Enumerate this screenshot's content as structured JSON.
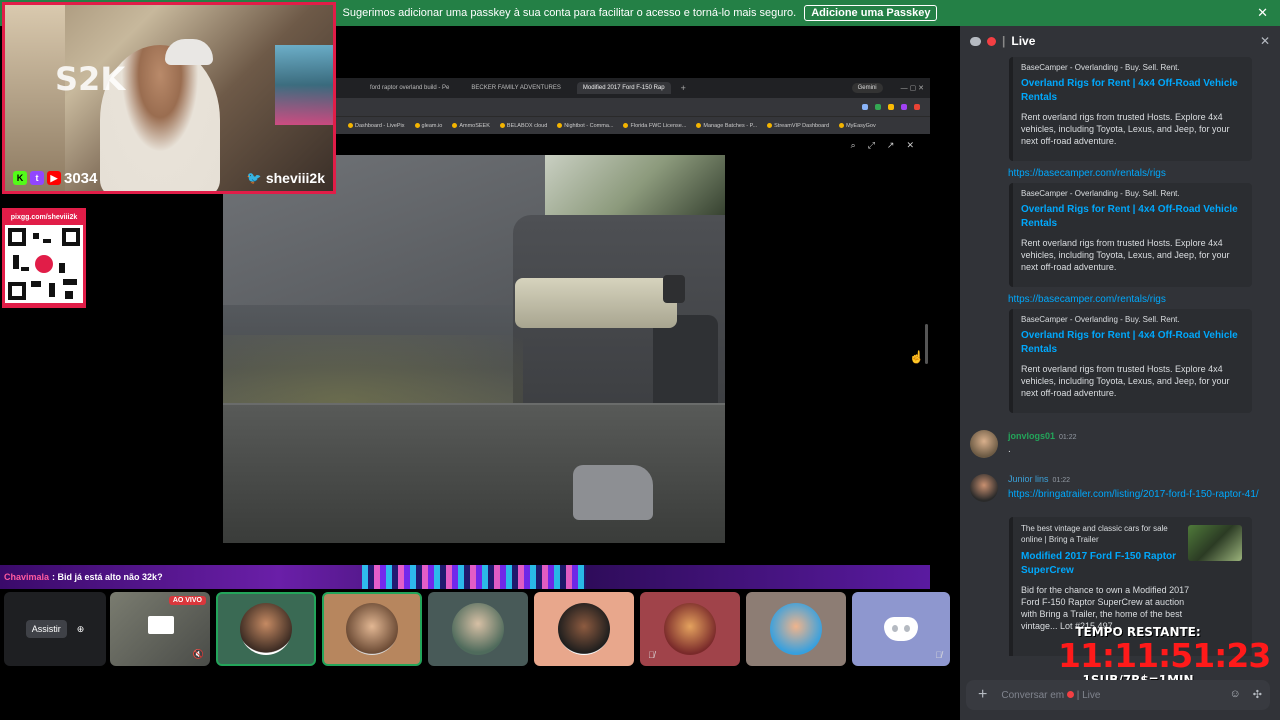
{
  "banner": {
    "text": "Sugerimos adicionar uma passkey à sua conta para facilitar o acesso e torná-lo mais seguro.",
    "button": "Adicione uma Passkey",
    "close": "✕"
  },
  "browser": {
    "tabs": [
      "ford raptor overland build - Pe",
      "BECKER FAMILY ADVENTURES",
      "Modified 2017 Ford F-150 Rap"
    ],
    "gemini": "Gemini",
    "bookmarks": [
      "Dashboard - LivePix",
      "gleam.io",
      "AmmoSEEK",
      "BELABOX cloud",
      "Nightbot - Comma...",
      "Florida FWC License...",
      "Manage Batches - P...",
      "StreamVIP Dashboard",
      "MyEasyGov"
    ]
  },
  "webcam": {
    "viewer_count": "3034",
    "handle": "sheviii2k",
    "logo": "S2K"
  },
  "qr": {
    "label": "pixgg.com/sheviii2k"
  },
  "chat_strip": {
    "user": "Chavimala",
    "message": ": Bid já está alto não 32k?"
  },
  "tiles": {
    "watch_label": "Assistir",
    "live_badge": "AO VIVO"
  },
  "chat_panel": {
    "title": "Live",
    "embeds": [
      {
        "provider": "BaseCamper - Overlanding - Buy. Sell. Rent.",
        "title": "Overland Rigs for Rent | 4x4 Off-Road Vehicle Rentals",
        "description": "Rent overland rigs from trusted Hosts. Explore 4x4 vehicles, including Toyota, Lexus, and Jeep, for your next off-road adventure."
      },
      {
        "link": "https://basecamper.com/rentals/rigs",
        "provider": "BaseCamper - Overlanding - Buy. Sell. Rent.",
        "title": "Overland Rigs for Rent | 4x4 Off-Road Vehicle Rentals",
        "description": "Rent overland rigs from trusted Hosts. Explore 4x4 vehicles, including Toyota, Lexus, and Jeep, for your next off-road adventure."
      },
      {
        "link": "https://basecamper.com/rentals/rigs",
        "provider": "BaseCamper - Overlanding - Buy. Sell. Rent.",
        "title": "Overland Rigs for Rent | 4x4 Off-Road Vehicle Rentals",
        "description": "Rent overland rigs from trusted Hosts. Explore 4x4 vehicles, including Toyota, Lexus, and Jeep, for your next off-road adventure."
      }
    ],
    "messages": [
      {
        "user": "jonvlogs01",
        "time": "01:22",
        "text": ".",
        "color": "#23a55a"
      },
      {
        "user": "Junior lins",
        "time": "01:22",
        "link": "https://bringatrailer.com/listing/2017-ford-f-150-raptor-41/",
        "color": "#3ba1d8"
      }
    ],
    "bat_embed": {
      "provider": "The best vintage and classic cars for sale online | Bring a Trailer",
      "title": "Modified 2017 Ford F-150 Raptor SuperCrew",
      "description": "Bid for the chance to own a Modified 2017 Ford F-150 Raptor SuperCrew at auction with Bring a Trailer, the home of the best vintage... Lot #215,497."
    },
    "input_placeholder": "Conversar em",
    "input_channel": "Live"
  },
  "timer": {
    "label": "TEMPO RESTANTE:",
    "clock": "11:11:51:23",
    "rate": "1SUB/7R$=1MIN"
  },
  "colors": {
    "banner": "#248046",
    "accent": "#e11d48",
    "link": "#00a8fc",
    "timer": "#ff1a1a"
  }
}
